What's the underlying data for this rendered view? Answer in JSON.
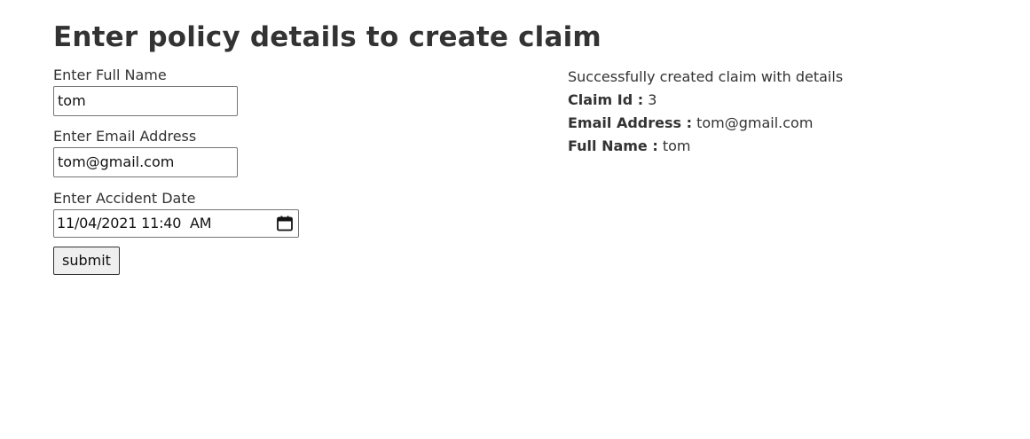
{
  "page": {
    "title": "Enter policy details to create claim"
  },
  "form": {
    "full_name_label": "Enter Full Name",
    "full_name_value": "tom",
    "email_label": "Enter Email Address",
    "email_value": "tom@gmail.com",
    "accident_date_label": "Enter Accident Date",
    "accident_date_value": "11/04/2021 11:40  AM",
    "submit_label": "submit",
    "calendar_icon": "calendar-icon"
  },
  "result": {
    "message": "Successfully created claim with details",
    "claim_id_key": "Claim Id :",
    "claim_id_value": "3",
    "email_key": "Email Address :",
    "email_value": "tom@gmail.com",
    "full_name_key": "Full Name :",
    "full_name_value": "tom"
  }
}
